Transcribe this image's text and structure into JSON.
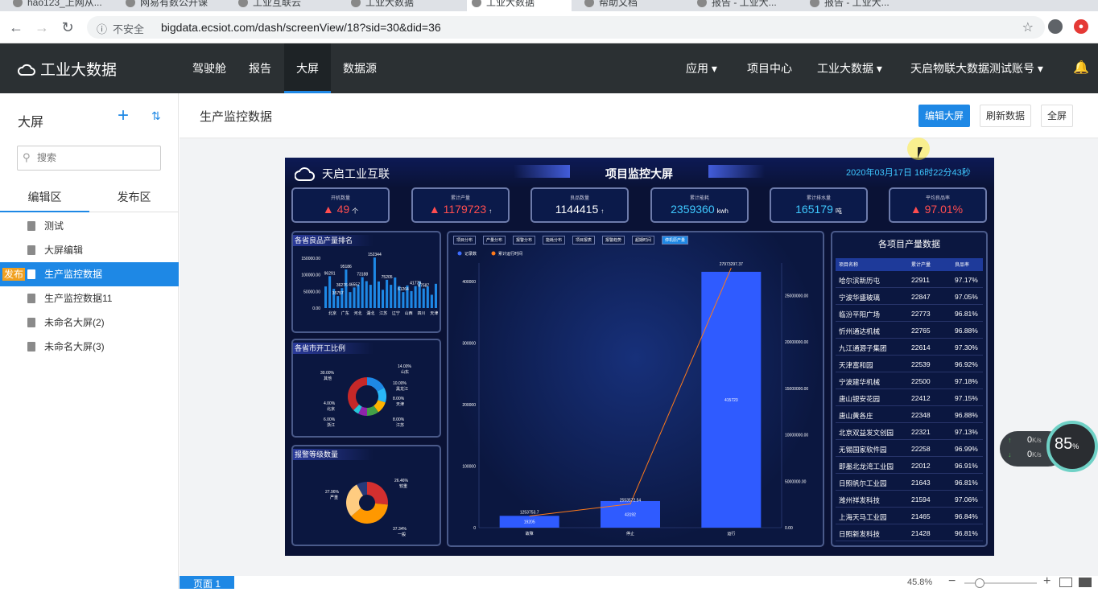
{
  "browser": {
    "tabs": [
      {
        "label": "hao123_上网从...",
        "active": false
      },
      {
        "label": "网易有数公开课",
        "active": false
      },
      {
        "label": "工业互联云",
        "active": false
      },
      {
        "label": "工业大数据",
        "active": false
      },
      {
        "label": "工业大数据",
        "active": true
      },
      {
        "label": "帮助文档",
        "active": false
      },
      {
        "label": "报告 - 工业大...",
        "active": false
      },
      {
        "label": "报告 - 工业大...",
        "active": false
      }
    ],
    "insecure_label": "不安全",
    "url": "bigdata.ecsiot.com/dash/screenView/18?sid=30&did=36"
  },
  "app": {
    "logo": "工业大数据",
    "nav": [
      "驾驶舱",
      "报告",
      "大屏",
      "数据源"
    ],
    "nav_active": "大屏",
    "right_nav": {
      "apps": "应用",
      "project_center": "项目中心",
      "industry": "工业大数据",
      "account": "天启物联大数据测试账号"
    }
  },
  "sidebar": {
    "title": "大屏",
    "search_placeholder": "搜索",
    "tabs": [
      "编辑区",
      "发布区"
    ],
    "publish_badge": "发布",
    "items": [
      "测试",
      "大屏编辑",
      "生产监控数据",
      "生产监控数据11",
      "未命名大屏(2)",
      "未命名大屏(3)"
    ],
    "selected_index": 2
  },
  "content": {
    "title": "生产监控数据",
    "buttons": {
      "edit": "编辑大屏",
      "refresh": "刷新数据",
      "fullscreen": "全屏"
    },
    "page_tab": "页面 1",
    "zoom": "45.8%"
  },
  "dashboard": {
    "brand": "天启工业互联",
    "title": "项目监控大屏",
    "datetime": "2020年03月17日 16时22分43秒",
    "kpis": [
      {
        "label": "开机数量",
        "value": "49",
        "unit": "个",
        "color": "#ff4d4f",
        "arrow": "▲"
      },
      {
        "label": "累计产量",
        "value": "1179723",
        "unit": "↑",
        "color": "#ff4d4f",
        "arrow": "▲"
      },
      {
        "label": "良品数量",
        "value": "1144415",
        "unit": "↑",
        "color": "#ffffff",
        "arrow": ""
      },
      {
        "label": "累计能耗",
        "value": "2359360",
        "unit": "kwh",
        "color": "#3ec8ff",
        "arrow": ""
      },
      {
        "label": "累计排水量",
        "value": "165179",
        "unit": "吨",
        "color": "#3ec8ff",
        "arrow": ""
      },
      {
        "label": "平均良品率",
        "value": "97.01%",
        "unit": "",
        "color": "#ff4d4f",
        "arrow": "▲"
      }
    ],
    "province_title": "各省良品产量排名",
    "province_chart": {
      "y_ticks": [
        "150000.00",
        "100000.00",
        "50000.00",
        "0.00"
      ],
      "max": 150000,
      "bars": [
        65000,
        96000,
        58000,
        36000,
        60000,
        116000,
        48000,
        62000,
        70000,
        93000,
        81000,
        70000,
        152000,
        80000,
        55000,
        85000,
        70000,
        92000,
        66000,
        48000,
        68000,
        51000,
        66000,
        80000,
        59000,
        65000,
        40000,
        73000
      ],
      "labels": [
        {
          "text": "96291",
          "i": 1
        },
        {
          "text": "95186",
          "i": 5
        },
        {
          "text": "73188",
          "i": 9
        },
        {
          "text": "152344",
          "i": 12
        },
        {
          "text": "75205",
          "i": 15
        },
        {
          "text": "67587",
          "i": 24
        },
        {
          "text": "46557",
          "i": 7
        },
        {
          "text": "61264",
          "i": 19
        },
        {
          "text": "35757",
          "i": 3
        },
        {
          "text": "36276",
          "i": 4
        },
        {
          "text": "41779",
          "i": 22
        }
      ],
      "x_labels": [
        "北京",
        "广东",
        "河北",
        "湖北",
        "江苏",
        "辽宁",
        "山西",
        "四川",
        "天津"
      ]
    },
    "city_title": "各省市开工比例",
    "city_pie": [
      {
        "name": "山东",
        "pct": "14.00%",
        "value": 14,
        "color": "#1e88e5"
      },
      {
        "name": "黑龙江",
        "pct": "10.00%",
        "value": 10,
        "color": "#29b6f6"
      },
      {
        "name": "天津",
        "pct": "8.00%",
        "value": 8,
        "color": "#ffb300"
      },
      {
        "name": "江苏",
        "pct": "8.00%",
        "value": 8,
        "color": "#43a047"
      },
      {
        "name": "浙江",
        "pct": "6.00%",
        "value": 6,
        "color": "#8e24aa"
      },
      {
        "name": "北京",
        "pct": "4.00%",
        "value": 4,
        "color": "#26c6da"
      },
      {
        "name": "其他",
        "pct": "30.00%",
        "value": 30,
        "color": "#c62828"
      }
    ],
    "alarm_title": "报警等级数量",
    "alarm_pie": [
      {
        "name": "较重",
        "pct": "26.46%",
        "value": 26.46,
        "color": "#d32f2f"
      },
      {
        "name": "一般",
        "pct": "37.34%",
        "value": 37.34,
        "color": "#ff9800"
      },
      {
        "name": "严重",
        "pct": "27.96%",
        "value": 27.96,
        "color": "#ffcc80"
      },
      {
        "name": "",
        "pct": "",
        "value": 8.24,
        "color": "#263a7a"
      }
    ],
    "main_tabs": [
      "项目分布",
      "产量分布",
      "报警分布",
      "能耗分布",
      "项目报表",
      "报警趋势",
      "超期时间",
      "停机原产量"
    ],
    "main_tab_active": 7,
    "legend": [
      "记录数",
      "累计运行时间"
    ],
    "chart_data": {
      "type": "bar",
      "categories": [
        "故障",
        "停止",
        "运行"
      ],
      "series": [
        {
          "name": "记录数",
          "values": [
            19205,
            43192,
            415723
          ]
        },
        {
          "name": "累计运行时间",
          "values": [
            1253753.7,
            2553572.54,
            27973297.37
          ]
        }
      ],
      "bar_labels": [
        "19205",
        "43192",
        "415723"
      ],
      "line_labels": [
        "1253753.7",
        "2553572.54",
        "27973297.37"
      ],
      "y_left_ticks": [
        "400000",
        "300000",
        "200000",
        "100000",
        "0"
      ],
      "y_right_ticks": [
        "25000000.00",
        "20000000.00",
        "15000000.00",
        "10000000.00",
        "5000000.00",
        "0.00"
      ],
      "ylim_left": [
        0,
        430000
      ],
      "ylim_right": [
        0,
        28500000
      ]
    },
    "project_table": {
      "title": "各项目产量数据",
      "headers": [
        "项目名称",
        "累计产量",
        "良品率"
      ],
      "rows": [
        [
          "哈尔滨新历屯",
          "22911",
          "97.17%"
        ],
        [
          "宁波华盛玻璃",
          "22847",
          "97.05%"
        ],
        [
          "临汾平阳广场",
          "22773",
          "96.81%"
        ],
        [
          "忻州通达机械",
          "22765",
          "96.88%"
        ],
        [
          "九江通源子集团",
          "22614",
          "97.30%"
        ],
        [
          "天津富和园",
          "22539",
          "96.92%"
        ],
        [
          "宁波建华机械",
          "22500",
          "97.18%"
        ],
        [
          "唐山银安花园",
          "22412",
          "97.15%"
        ],
        [
          "唐山黄各庄",
          "22348",
          "96.88%"
        ],
        [
          "北京双益发文创园",
          "22321",
          "97.13%"
        ],
        [
          "无锡国家软件园",
          "22258",
          "96.99%"
        ],
        [
          "即墨北龙湾工业园",
          "22012",
          "96.91%"
        ],
        [
          "日照帆尔工业园",
          "21643",
          "96.81%"
        ],
        [
          "潍州祥发科技",
          "21594",
          "97.06%"
        ],
        [
          "上海天马工业园",
          "21465",
          "96.84%"
        ],
        [
          "日照新发科技",
          "21428",
          "96.81%"
        ]
      ]
    }
  },
  "system": {
    "net_up": "0",
    "net_down": "0",
    "net_unit": "K/s",
    "cpu": "85",
    "cpu_unit": "%"
  }
}
